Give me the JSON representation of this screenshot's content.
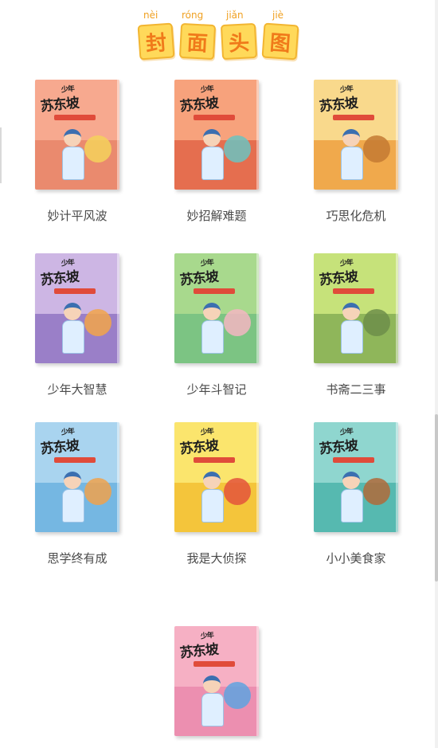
{
  "header": {
    "pinyin": [
      "nèi",
      "róng",
      "jiǎn",
      "jiè"
    ],
    "title_chars": [
      "封",
      "面",
      "头",
      "图"
    ]
  },
  "books": [
    {
      "title": "妙计平风波",
      "sky": "#f7a98f",
      "ground": "#ea8a6e",
      "accent": "#f5d15c"
    },
    {
      "title": "妙招解难题",
      "sky": "#f7a27c",
      "ground": "#e56e4f",
      "accent": "#6cc3c0"
    },
    {
      "title": "巧思化危机",
      "sky": "#f9d98c",
      "ground": "#f0a94c",
      "accent": "#c47a32"
    },
    {
      "title": "少年大智慧",
      "sky": "#cdb6e4",
      "ground": "#9a7fc8",
      "accent": "#f2a54a"
    },
    {
      "title": "少年斗智记",
      "sky": "#a8d98d",
      "ground": "#7cc483",
      "accent": "#f4b6c2"
    },
    {
      "title": "书斋二三事",
      "sky": "#c6e27a",
      "ground": "#8fb65a",
      "accent": "#6d8e4a"
    },
    {
      "title": "思学终有成",
      "sky": "#a9d4ef",
      "ground": "#75b7e2",
      "accent": "#f0a24c"
    },
    {
      "title": "我是大侦探",
      "sky": "#fbe56d",
      "ground": "#f4c53b",
      "accent": "#e3543c"
    },
    {
      "title": "小小美食家",
      "sky": "#8fd6cf",
      "ground": "#56b9b0",
      "accent": "#b06a3a"
    },
    {
      "title": "",
      "sky": "#f6b0c4",
      "ground": "#ec8fb0",
      "accent": "#5fa3e0"
    }
  ],
  "logo_text": "苏东坡",
  "logo_prefix": "少年"
}
